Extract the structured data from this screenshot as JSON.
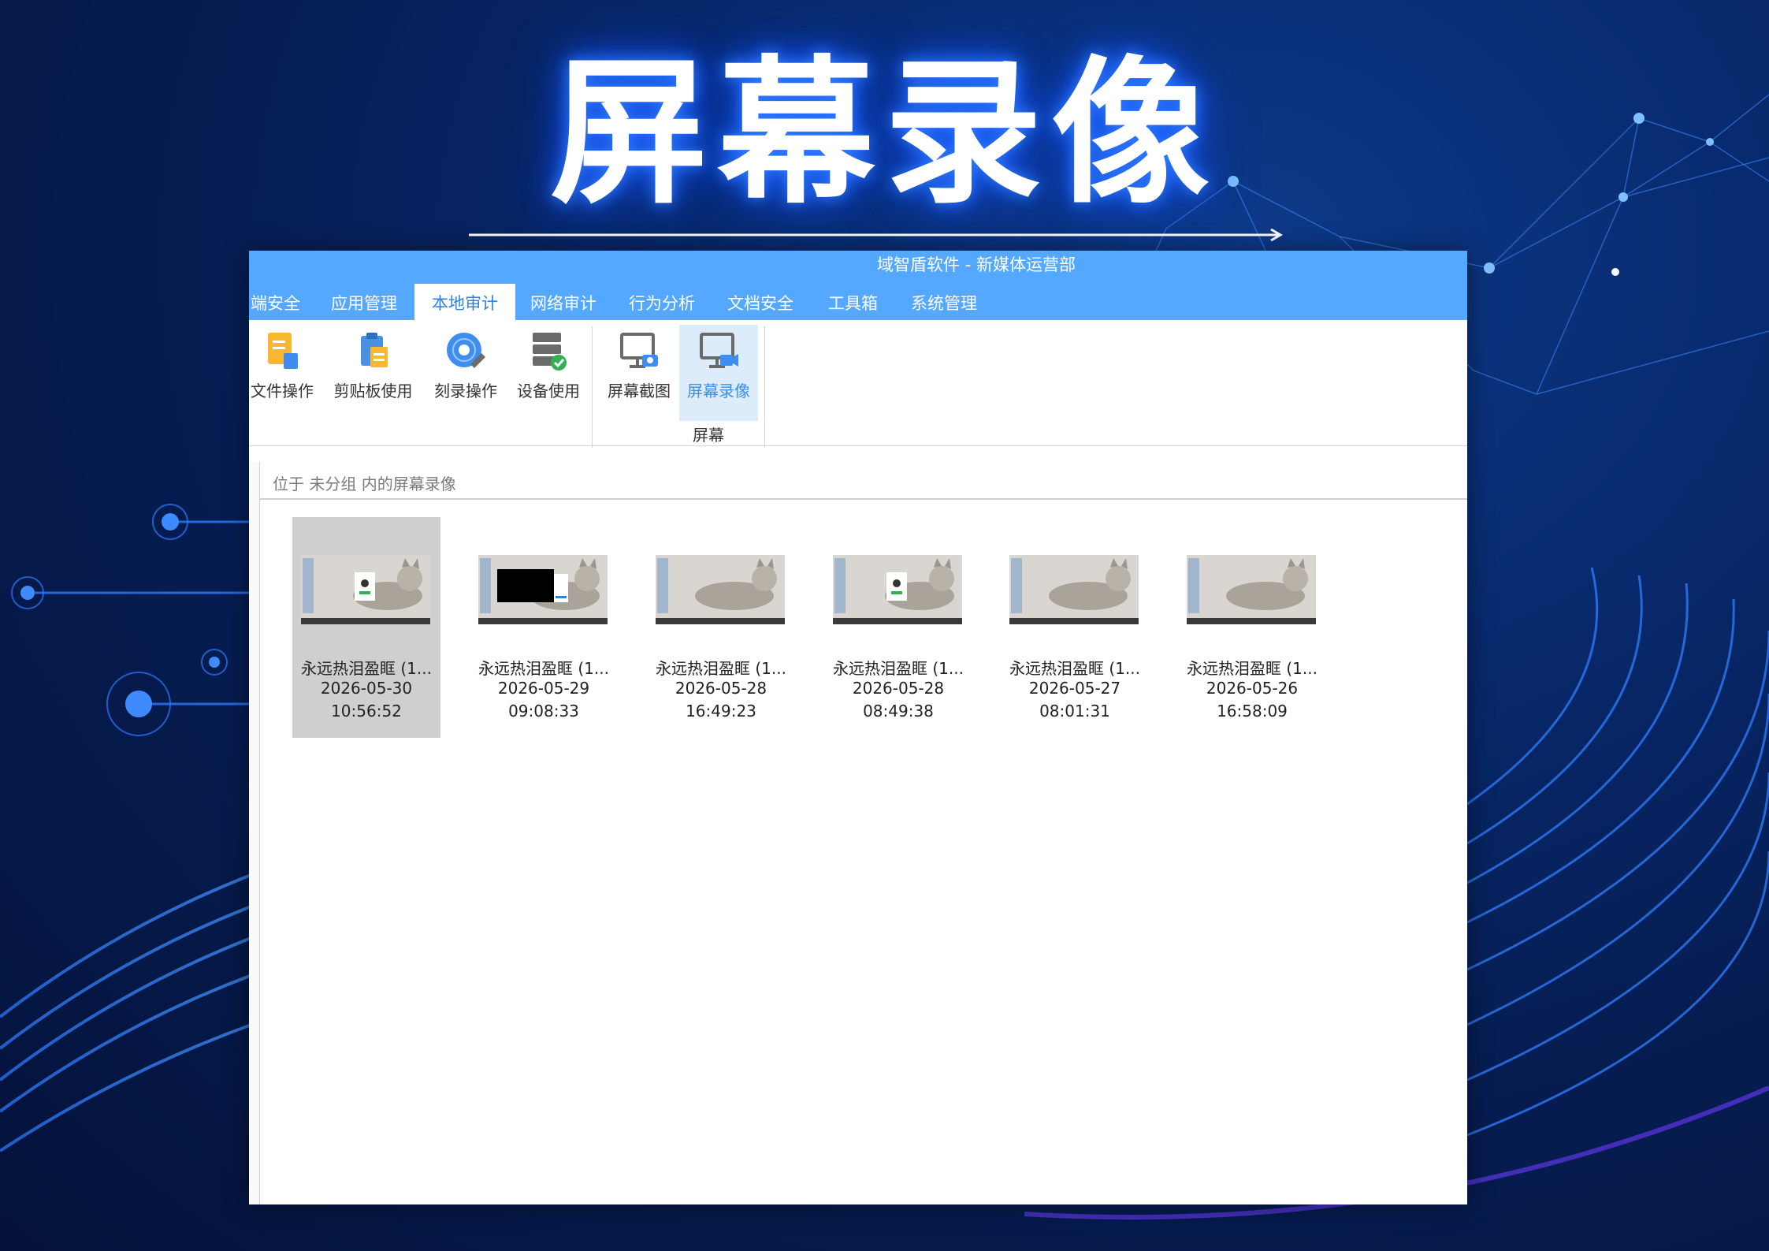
{
  "hero": {
    "title": "屏幕录像"
  },
  "window": {
    "title": "域智盾软件 - 新媒体运营部",
    "menu_tabs": [
      {
        "label": "端安全",
        "active": false
      },
      {
        "label": "应用管理",
        "active": false
      },
      {
        "label": "本地审计",
        "active": true
      },
      {
        "label": "网络审计",
        "active": false
      },
      {
        "label": "行为分析",
        "active": false
      },
      {
        "label": "文档安全",
        "active": false
      },
      {
        "label": "工具箱",
        "active": false
      },
      {
        "label": "系统管理",
        "active": false
      }
    ],
    "ribbon": {
      "buttons": [
        {
          "label": "文件操作",
          "icon": "file-operation-icon"
        },
        {
          "label": "剪贴板使用",
          "icon": "clipboard-icon"
        },
        {
          "label": "刻录操作",
          "icon": "disc-burn-icon"
        },
        {
          "label": "设备使用",
          "icon": "device-usage-icon"
        },
        {
          "label": "屏幕截图",
          "icon": "screenshot-icon"
        },
        {
          "label": "屏幕录像",
          "icon": "screen-record-icon",
          "selected": true
        }
      ],
      "group_label": "屏幕"
    },
    "breadcrumb": "位于 未分组 内的屏幕录像",
    "recordings": [
      {
        "name": "永远热泪盈眶 (1...",
        "date": "2026-05-30",
        "time": "10:56:52",
        "selected": true
      },
      {
        "name": "永远热泪盈眶 (1...",
        "date": "2026-05-29",
        "time": "09:08:33",
        "selected": false
      },
      {
        "name": "永远热泪盈眶 (1...",
        "date": "2026-05-28",
        "time": "16:49:23",
        "selected": false
      },
      {
        "name": "永远热泪盈眶 (1...",
        "date": "2026-05-28",
        "time": "08:49:38",
        "selected": false
      },
      {
        "name": "永远热泪盈眶 (1...",
        "date": "2026-05-27",
        "time": "08:01:31",
        "selected": false
      },
      {
        "name": "永远热泪盈眶 (1...",
        "date": "2026-05-26",
        "time": "16:58:09",
        "selected": false
      }
    ],
    "colors": {
      "title_bar": "#55a8ff",
      "active_tab_text": "#2f82e0",
      "selection": "#cfcfcf"
    }
  }
}
